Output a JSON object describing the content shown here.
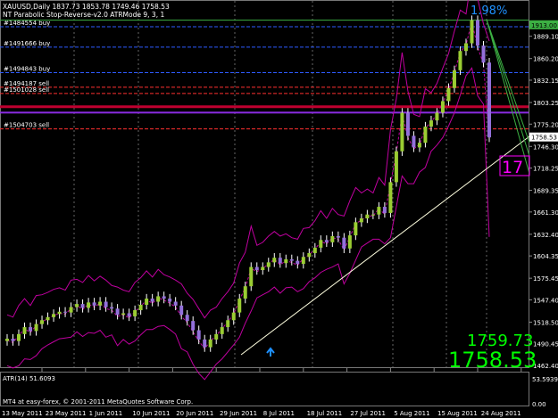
{
  "window": {
    "symbol_line": "XAUUSD,Daily  1837.73 1853.78 1749.46 1758.53",
    "indicator_line": "NT Parabolic Stop-Reverse-v2.0 ATRMode 9, 3, 1",
    "percent_label": "1.98%",
    "big_price_top": "1759.73",
    "big_price_bottom": "1758.53",
    "side_value": "17",
    "atr_label": "ATR(14) 51.6093",
    "copyright": "MT4 at easy-forex, © 2001-2011 MetaQuotes Software Corp.",
    "atr_scale_top": "53.5939",
    "atr_scale_bottom": "0.00"
  },
  "orders": [
    {
      "label": "#1484554 buy",
      "price": 1901.5
    },
    {
      "label": "#1491666 buy",
      "price": 1875.0
    },
    {
      "label": "#1494843 buy",
      "price": 1842.0
    },
    {
      "label": "#1494187 sell",
      "price": 1823.0
    },
    {
      "label": "#1501028 sell",
      "price": 1815.0
    },
    {
      "label": "#1504703 sell",
      "price": 1769.0
    }
  ],
  "price_axis": {
    "ticks": [
      "1889.10",
      "1860.20",
      "1832.15",
      "1803.25",
      "1775.20",
      "1746.30",
      "1718.25",
      "1689.35",
      "1661.30",
      "1632.40",
      "1604.35",
      "1575.45",
      "1547.40",
      "1518.50",
      "1490.45",
      "1462.40"
    ],
    "current_top": "1913.00",
    "current_price": "1758.53",
    "min": 1462.4,
    "max": 1913.0
  },
  "time_axis": [
    "13 May 2011",
    "23 May 2011",
    "1 Jun 2011",
    "10 Jun 2011",
    "20 Jun 2011",
    "29 Jun 2011",
    "8 Jul 2011",
    "18 Jul 2011",
    "27 Jul 2011",
    "5 Aug 2011",
    "15 Aug 2011",
    "24 Aug 2011"
  ],
  "colors": {
    "bull": "#9ACD32",
    "bear": "#9370DB",
    "band": "#C000A0",
    "text": "#FFFFFF",
    "green_text": "#00FF00"
  },
  "chart_data": {
    "type": "candlestick",
    "x": [
      "2011-05-13",
      "2011-08-24"
    ],
    "close": [
      1497,
      1494,
      1503,
      1512,
      1507,
      1516,
      1521,
      1525,
      1529,
      1532,
      1531,
      1538,
      1542,
      1537,
      1544,
      1540,
      1545,
      1538,
      1536,
      1528,
      1530,
      1526,
      1534,
      1541,
      1549,
      1545,
      1552,
      1549,
      1545,
      1540,
      1528,
      1520,
      1508,
      1496,
      1486,
      1496,
      1503,
      1512,
      1521,
      1531,
      1549,
      1565,
      1590,
      1586,
      1590,
      1596,
      1602,
      1595,
      1600,
      1598,
      1594,
      1603,
      1608,
      1615,
      1625,
      1622,
      1630,
      1628,
      1614,
      1631,
      1648,
      1653,
      1658,
      1658,
      1668,
      1660,
      1700,
      1740,
      1790,
      1760,
      1745,
      1751,
      1772,
      1780,
      1790,
      1805,
      1822,
      1845,
      1870,
      1880,
      1910,
      1877,
      1855,
      1758
    ]
  }
}
